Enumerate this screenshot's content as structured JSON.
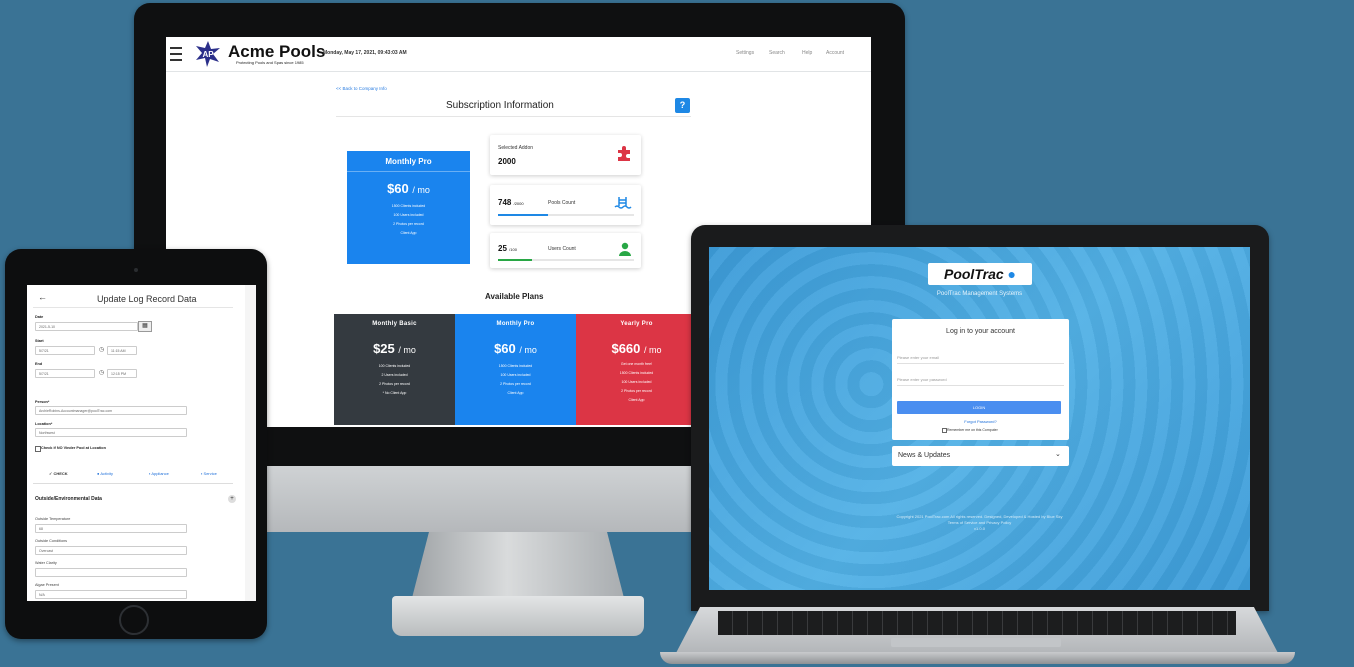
{
  "desktop": {
    "brand": "Acme Pools",
    "logo_text": "AP",
    "tagline": "Protecting Pools and Spas since 1985",
    "date": "Monday, May 17, 2021, 09:43:03 AM",
    "nav": [
      "Settings",
      "Search",
      "Help",
      "Account"
    ],
    "back_link": "<< Back to Company Info",
    "page_title": "Subscription Information",
    "help_label": "?",
    "current_plan": {
      "name": "Monthly Pro",
      "price": "$60",
      "period": "/ mo",
      "features": [
        "1500 Clients included",
        "100 Users included",
        "2 Photos per record",
        "Client App"
      ]
    },
    "selected_addon": {
      "label": "Selected Addon",
      "value": "2000"
    },
    "pools_count": {
      "value": "748",
      "limit": "/2000",
      "label": "Pools Count",
      "fraction": 0.37
    },
    "users_count": {
      "value": "25",
      "limit": "/100",
      "label": "Users Count",
      "fraction": 0.25
    },
    "available_title": "Available Plans",
    "plans": [
      {
        "name": "Monthly Basic",
        "price": "$25",
        "period": "/ mo",
        "color": "#343a40",
        "features": [
          "100 Clients included",
          "2 Users included",
          "2 Photos per record",
          "* No Client App"
        ]
      },
      {
        "name": "Monthly Pro",
        "price": "$60",
        "period": "/ mo",
        "color": "#1a84ee",
        "features": [
          "1500 Clients included",
          "100 Users included",
          "2 Photos per record",
          "Client App"
        ]
      },
      {
        "name": "Yearly Pro",
        "price": "$660",
        "period": "/ mo",
        "color": "#dc3545",
        "features": [
          "Get one month free!",
          "1500 Clients included",
          "100 Users included",
          "2 Photos per record",
          "Client App"
        ]
      }
    ]
  },
  "tablet": {
    "back": "←",
    "title": "Update Log Record Data",
    "date_label": "Date",
    "date_value": "2021-5-10",
    "start_label": "Start",
    "start_date": "5/7/21",
    "start_time": "11:15 AM",
    "end_label": "End",
    "end_date": "5/7/21",
    "end_time": "12:15 PM",
    "person_label": "Person*",
    "person_value": "ArchieRobins-Accountmanager@poolTrac.com",
    "location_label": "Location*",
    "location_value": "Northwest",
    "checkbox_label": "Check if NO Vinder Pool at Location",
    "tabs": [
      "CHECK",
      "Activity",
      "Appliance",
      "Service"
    ],
    "section": "Outside/Environmental Data",
    "section_btn": "+",
    "fields": [
      {
        "label": "Outside Temperature",
        "value": "68"
      },
      {
        "label": "Outside Conditions",
        "value": "Overcast"
      },
      {
        "label": "Water Clarity",
        "value": ""
      },
      {
        "label": "Algae Present",
        "value": "N/A"
      }
    ]
  },
  "laptop": {
    "logo": "PoolTrac",
    "subtitle": "PoolTrac Management Systems",
    "login_title": "Log in to your account",
    "email_placeholder": "Please enter your email",
    "password_placeholder": "Please enter your password",
    "login_btn": "LOGIN",
    "forgot": "Forgot Password?",
    "remember": "Remember me on this Computer",
    "news": "News & Updates",
    "footer_line1": "Copyright 2021 PoolTrac.com All rights reserved. Designed, Developed & Hosted by Blue Sky",
    "footer_line2": "Terms of Service and Privacy Policy",
    "footer_line3": "v1.0.0"
  },
  "colors": {
    "background": "#3a7395",
    "primary": "#1a84ee",
    "danger": "#dc3545",
    "dark": "#343a40"
  }
}
